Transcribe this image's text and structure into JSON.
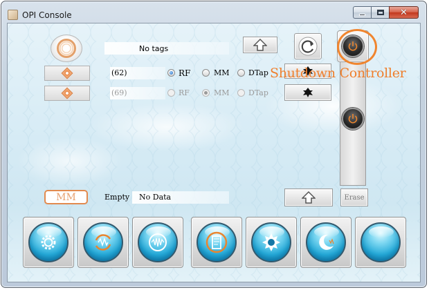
{
  "window": {
    "title": "OPI Console",
    "controls": {
      "minimize": "minimize",
      "maximize": "maximize",
      "close": "✕"
    }
  },
  "top": {
    "tags_label": "No tags"
  },
  "rows": [
    {
      "count": "(62)",
      "options": [
        "RF",
        "MM",
        "DTap"
      ],
      "selected": "RF",
      "enabled": true
    },
    {
      "count": "(69)",
      "options": [
        "RF",
        "MM",
        "DTap"
      ],
      "selected": "MM",
      "enabled": false
    }
  ],
  "annotation": {
    "text": "Shutdown Controller",
    "color": "#ef7f2c"
  },
  "bottom": {
    "mode_badge": "MM",
    "status_label": "Empty",
    "data_label": "No Data",
    "erase_label": "Erase"
  },
  "big_buttons": [
    {
      "icon": "gear-icon"
    },
    {
      "icon": "refresh-wave-icon"
    },
    {
      "icon": "signal-wave-icon"
    },
    {
      "icon": "card-icon"
    },
    {
      "icon": "sun-settings-icon"
    },
    {
      "icon": "moon-icon"
    },
    {
      "icon": "blank-orb-icon"
    }
  ],
  "colors": {
    "accent_orange": "#ef7f2c",
    "orb_blue": "#23a9d8"
  }
}
